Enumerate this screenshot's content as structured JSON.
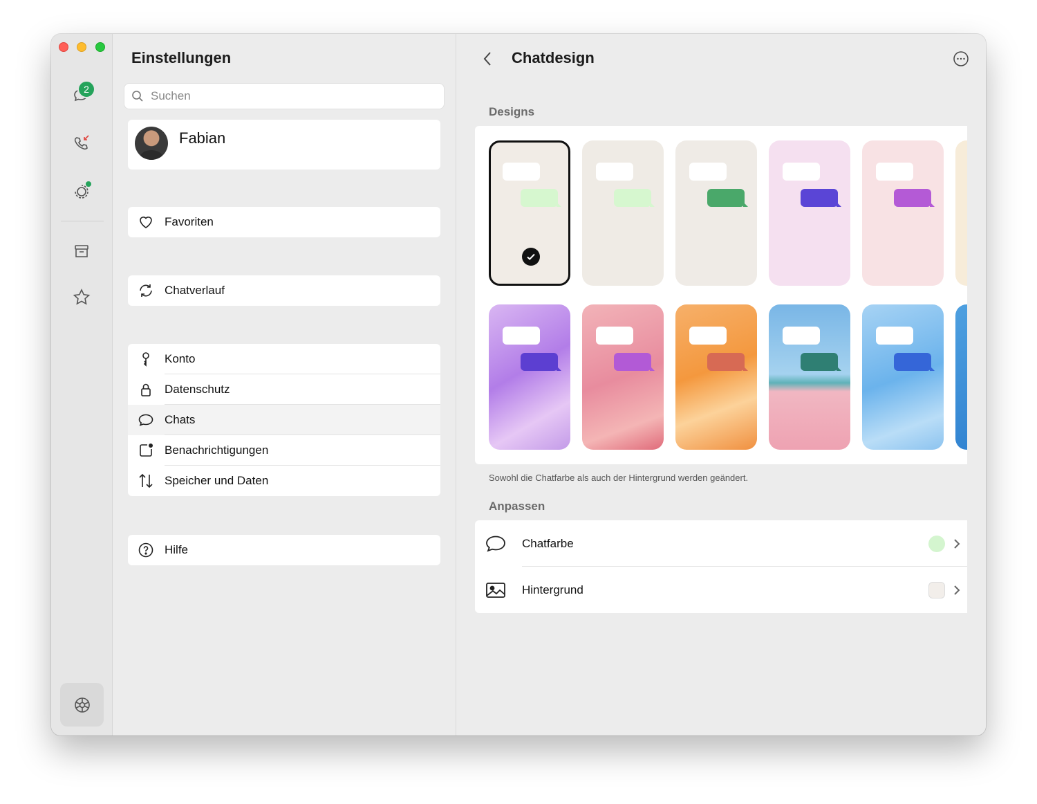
{
  "sidebar": {
    "chats_badge": "2",
    "items": [
      {
        "icon": "chats-icon"
      },
      {
        "icon": "calls-icon"
      },
      {
        "icon": "status-icon"
      },
      {
        "icon": "archive-icon"
      },
      {
        "icon": "starred-icon"
      },
      {
        "icon": "settings-icon"
      }
    ]
  },
  "settings": {
    "title": "Einstellungen",
    "search_placeholder": "Suchen",
    "profile_name": "Fabian",
    "favorites": "Favoriten",
    "chat_history": "Chatverlauf",
    "account": "Konto",
    "privacy": "Datenschutz",
    "chats": "Chats",
    "notifications": "Benachrichtigungen",
    "storage": "Speicher und Daten",
    "help": "Hilfe"
  },
  "detail": {
    "title": "Chatdesign",
    "designs_label": "Designs",
    "caption": "Sowohl die Chatfarbe als auch der Hintergrund werden geändert.",
    "customize_label": "Anpassen",
    "chat_color_label": "Chatfarbe",
    "chat_color_value": "#d4f5cf",
    "background_label": "Hintergrund",
    "background_value": "#f2eeea"
  },
  "designs": [
    {
      "bg": "#f1ece6",
      "bubble": "#d6f7cf",
      "selected": true
    },
    {
      "bg": "#efebe5",
      "bubble": "#d6f7cf",
      "selected": false
    },
    {
      "bg": "#efebe6",
      "bubble": "#4aa86a",
      "selected": false
    },
    {
      "bg": "#f5e0f0",
      "bubble": "#5a45d6",
      "selected": false
    },
    {
      "bg": "#f8e2e4",
      "bubble": "#b45ad6",
      "selected": false
    },
    {
      "bg": "#f7ecd9",
      "bubble": "#c9a24e",
      "selected": false
    },
    {
      "bg": "linear-gradient(150deg,#d9b6f2,#b27de8 45%,#e6c7f5 75%,#c39be8)",
      "bubble": "#5c3fd1",
      "selected": false
    },
    {
      "bg": "linear-gradient(160deg,#f2b3b8,#e88c9e 50%,#f4b5b5 80%,#e06b7a)",
      "bubble": "#b25ad6",
      "selected": false
    },
    {
      "bg": "linear-gradient(160deg,#f6b06a,#f4983e 45%,#fcd29a 70%,#f09040)",
      "bubble": "#d76a54",
      "selected": false
    },
    {
      "bg": "linear-gradient(180deg,#79b6e6 0%,#a5d2ef 48%,#5fb2b8 54%,#f1b7c2 60%,#eea2b2 100%)",
      "bubble": "#2f7f73",
      "selected": false
    },
    {
      "bg": "linear-gradient(160deg,#a7d3f4,#6bb3ec 50%,#b9ddf7 80%,#8cc3ef)",
      "bubble": "#3566d8",
      "selected": false
    },
    {
      "bg": "linear-gradient(160deg,#4ea0e0,#2d7fcf)",
      "bubble": "#2c5fcf",
      "selected": false
    }
  ]
}
